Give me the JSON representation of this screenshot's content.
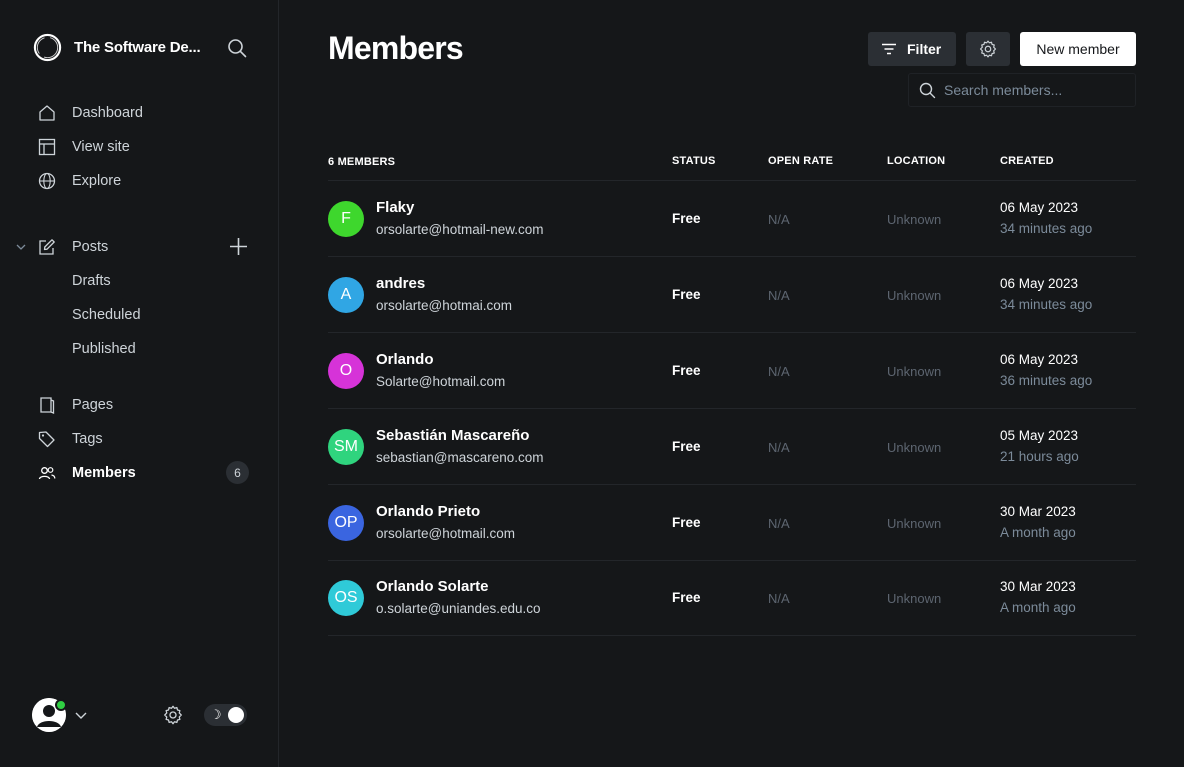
{
  "site": {
    "title": "The Software De..."
  },
  "nav": {
    "dashboard": "Dashboard",
    "view_site": "View site",
    "explore": "Explore",
    "posts": "Posts",
    "drafts": "Drafts",
    "scheduled": "Scheduled",
    "published": "Published",
    "pages": "Pages",
    "tags": "Tags",
    "members": "Members",
    "members_count": "6"
  },
  "header": {
    "title": "Members",
    "filter_label": "Filter",
    "new_member_label": "New member",
    "search_placeholder": "Search members..."
  },
  "table": {
    "col_members": "6 MEMBERS",
    "col_status": "STATUS",
    "col_open_rate": "OPEN RATE",
    "col_location": "LOCATION",
    "col_created": "CREATED",
    "rows": [
      {
        "initials": "F",
        "color": "#3ed72d",
        "name": "Flaky",
        "email": "orsolarte@hotmail-new.com",
        "status": "Free",
        "open_rate": "N/A",
        "location": "Unknown",
        "created": "06 May 2023",
        "ago": "34 minutes ago"
      },
      {
        "initials": "A",
        "color": "#30a6e4",
        "name": "andres",
        "email": "orsolarte@hotmai.com",
        "status": "Free",
        "open_rate": "N/A",
        "location": "Unknown",
        "created": "06 May 2023",
        "ago": "34 minutes ago"
      },
      {
        "initials": "O",
        "color": "#d633d8",
        "name": "Orlando",
        "email": "Solarte@hotmail.com",
        "status": "Free",
        "open_rate": "N/A",
        "location": "Unknown",
        "created": "06 May 2023",
        "ago": "36 minutes ago"
      },
      {
        "initials": "SM",
        "color": "#2fd47e",
        "name": "Sebastián Mascareño",
        "email": "sebastian@mascareno.com",
        "status": "Free",
        "open_rate": "N/A",
        "location": "Unknown",
        "created": "05 May 2023",
        "ago": "21 hours ago"
      },
      {
        "initials": "OP",
        "color": "#3a65e0",
        "name": "Orlando Prieto",
        "email": "orsolarte@hotmail.com",
        "status": "Free",
        "open_rate": "N/A",
        "location": "Unknown",
        "created": "30 Mar 2023",
        "ago": "A month ago"
      },
      {
        "initials": "OS",
        "color": "#2fcad8",
        "name": "Orlando Solarte",
        "email": "o.solarte@uniandes.edu.co",
        "status": "Free",
        "open_rate": "N/A",
        "location": "Unknown",
        "created": "30 Mar 2023",
        "ago": "A month ago"
      }
    ]
  },
  "footer": {
    "theme_icon": "moon-icon"
  }
}
